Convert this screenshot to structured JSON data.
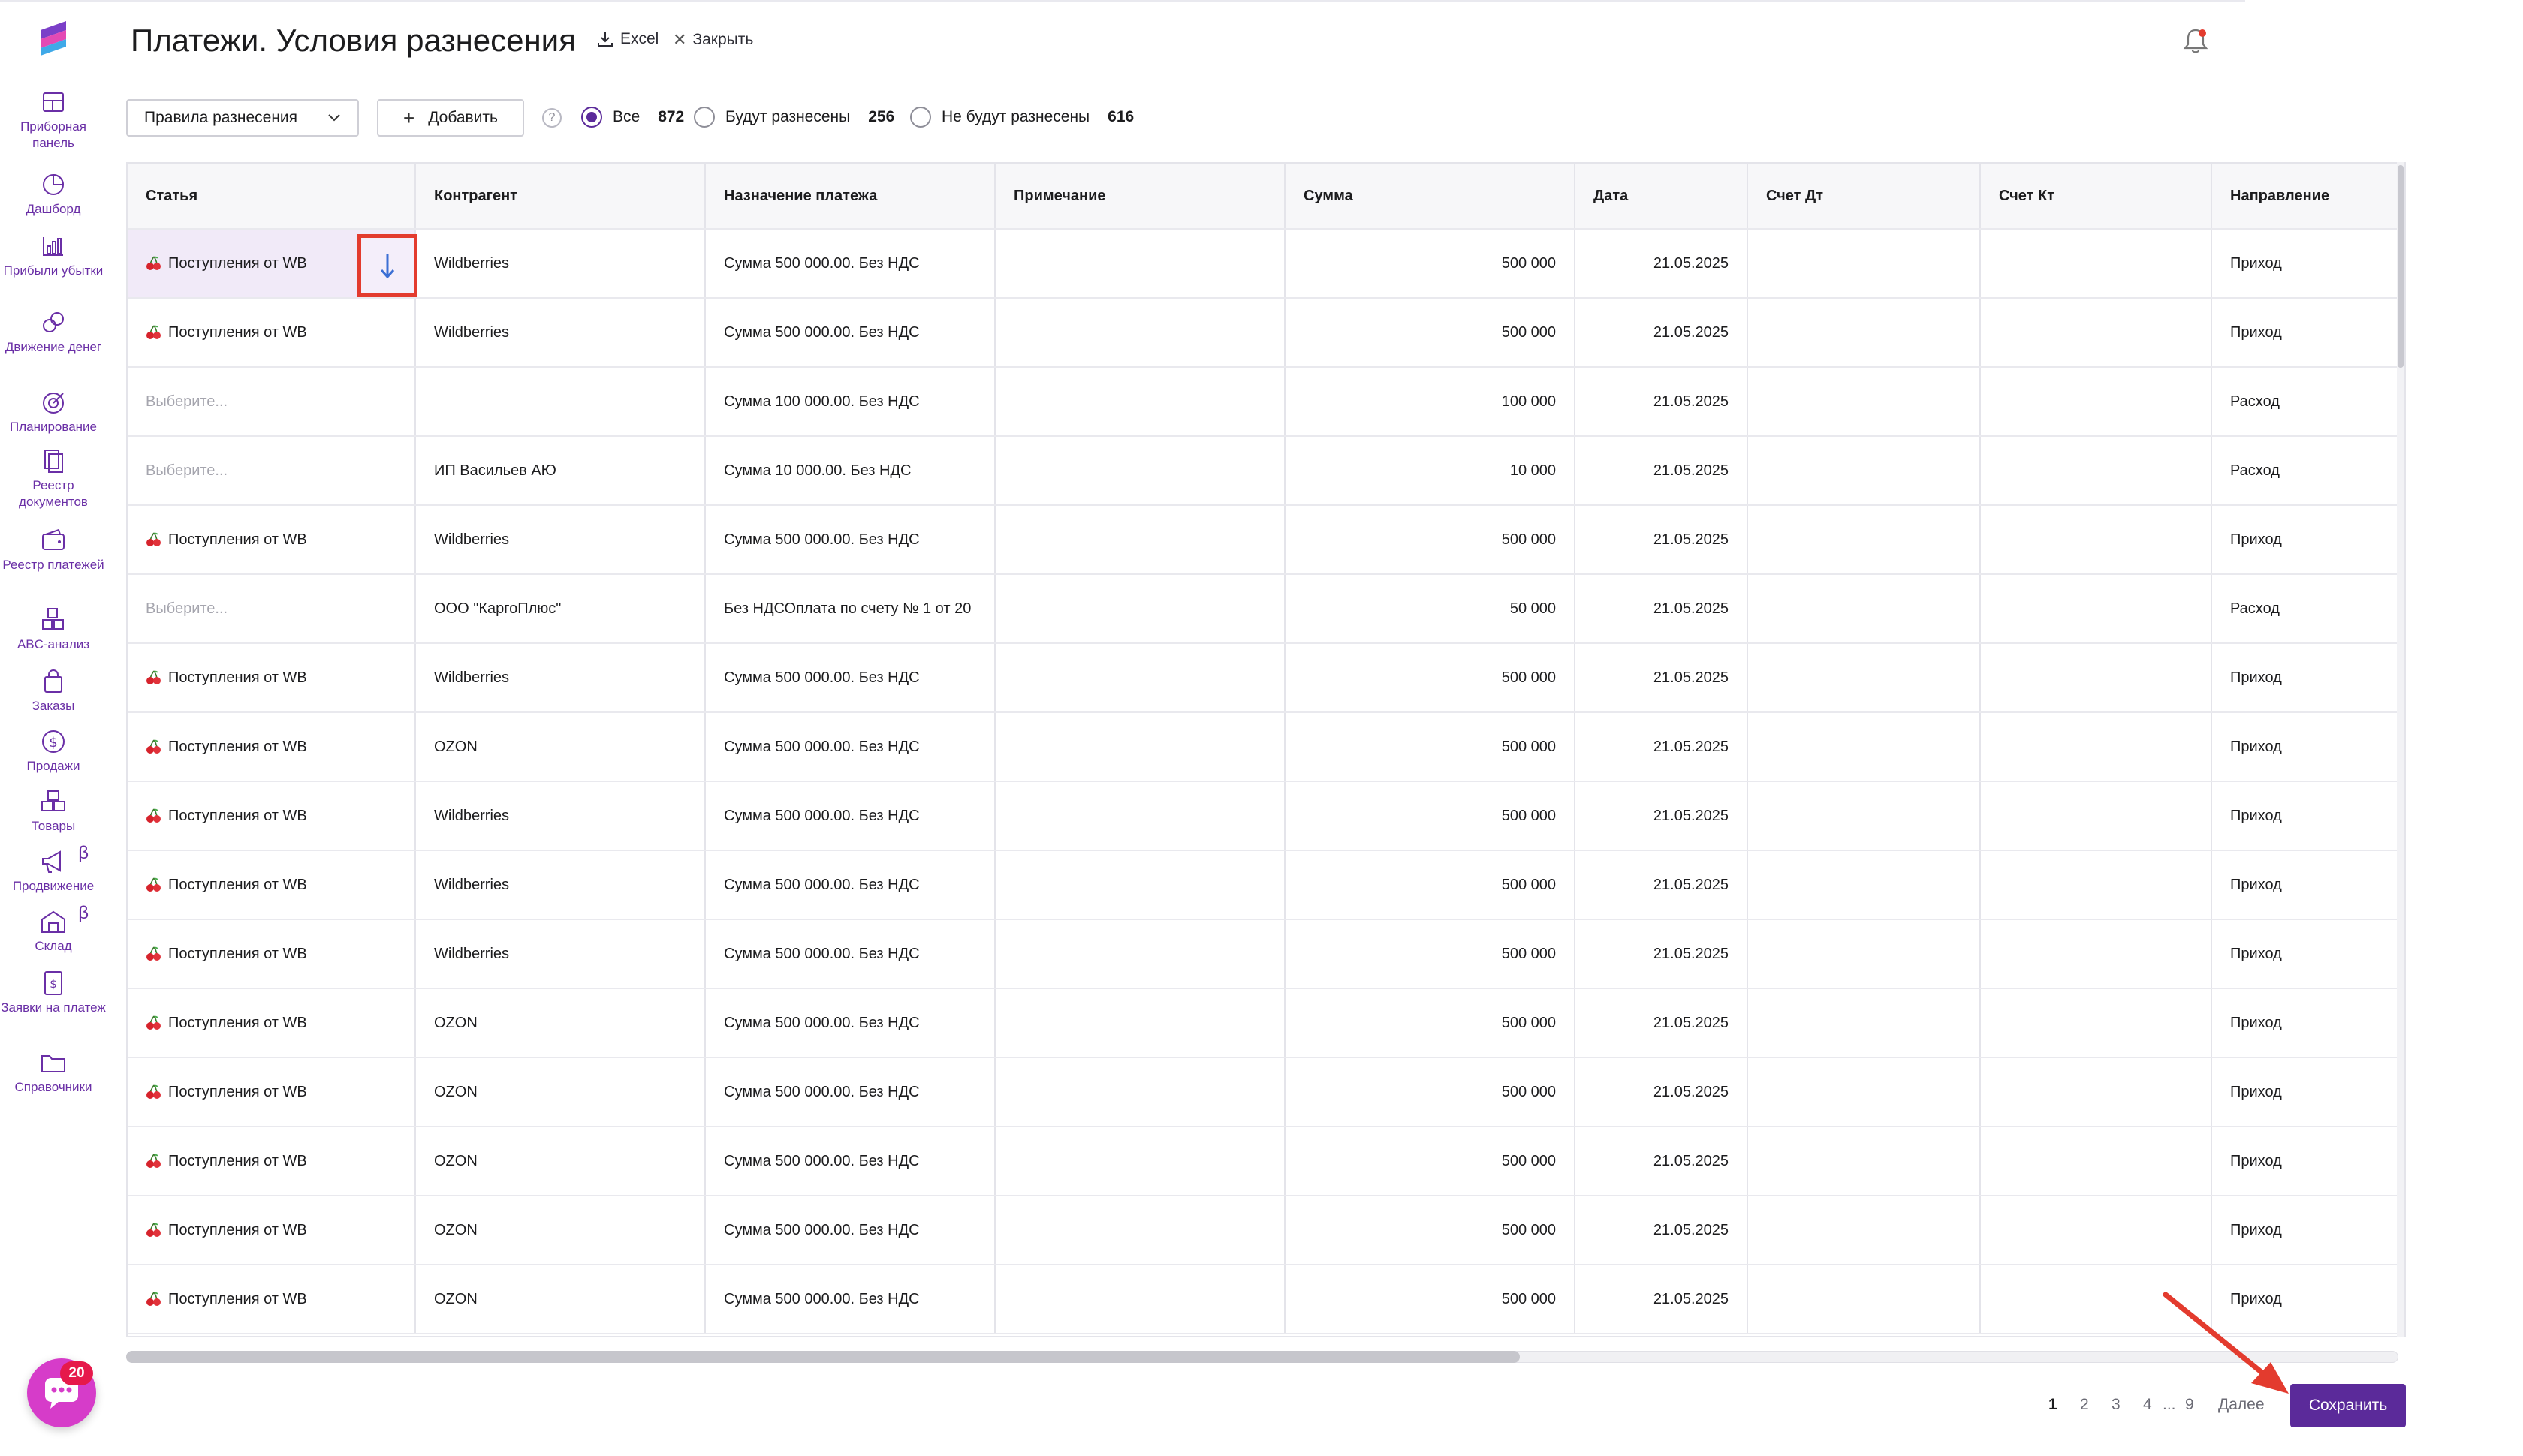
{
  "page": {
    "title": "Платежи. Условия разнесения",
    "excel_label": "Excel",
    "close_label": "Закрыть"
  },
  "sidebar": {
    "items": [
      {
        "label": "Приборная панель",
        "icon": "dashboard-panel-icon"
      },
      {
        "label": "Дашборд",
        "icon": "pie-chart-icon"
      },
      {
        "label": "Прибыли убытки",
        "icon": "bar-chart-icon"
      },
      {
        "label": "Движение денег",
        "icon": "money-flow-icon"
      },
      {
        "label": "Планирование",
        "icon": "target-icon"
      },
      {
        "label": "Реестр документов",
        "icon": "documents-icon"
      },
      {
        "label": "Реестр платежей",
        "icon": "wallet-icon"
      },
      {
        "label": "ABC-анализ",
        "icon": "abc-icon"
      },
      {
        "label": "Заказы",
        "icon": "shopping-bag-icon"
      },
      {
        "label": "Продажи",
        "icon": "dollar-icon"
      },
      {
        "label": "Товары",
        "icon": "boxes-icon"
      },
      {
        "label": "Продвижение",
        "icon": "megaphone-icon",
        "beta": "β"
      },
      {
        "label": "Склад",
        "icon": "warehouse-icon",
        "beta": "β"
      },
      {
        "label": "Заявки на платеж",
        "icon": "payment-request-icon"
      },
      {
        "label": "Справочники",
        "icon": "folder-icon"
      }
    ]
  },
  "chat": {
    "badge": "20"
  },
  "toolbar": {
    "rules_label": "Правила разнесения",
    "add_label": "Добавить",
    "help": "?",
    "filters": [
      {
        "label": "Все",
        "count": "872",
        "selected": true
      },
      {
        "label": "Будут разнесены",
        "count": "256",
        "selected": false
      },
      {
        "label": "Не будут разнесены",
        "count": "616",
        "selected": false
      }
    ]
  },
  "table": {
    "columns": [
      "Статья",
      "Контрагент",
      "Назначение платежа",
      "Примечание",
      "Сумма",
      "Дата",
      "Счет Дт",
      "Счет Кт",
      "Направление"
    ],
    "rows": [
      {
        "article": "Поступления от WB",
        "cherry": true,
        "counterparty": "Wildberries",
        "purpose": "Сумма 500 000.00. Без НДС",
        "note": "",
        "sum": "500 000",
        "date": "21.05.2025",
        "dt": "",
        "kt": "",
        "direction": "Приход"
      },
      {
        "article": "Поступления от WB",
        "cherry": true,
        "counterparty": "Wildberries",
        "purpose": "Сумма 500 000.00. Без НДС",
        "note": "",
        "sum": "500 000",
        "date": "21.05.2025",
        "dt": "",
        "kt": "",
        "direction": "Приход"
      },
      {
        "article": "Выберите...",
        "cherry": false,
        "counterparty": "",
        "purpose": "Сумма 100 000.00. Без НДС",
        "note": "",
        "sum": "100 000",
        "date": "21.05.2025",
        "dt": "",
        "kt": "",
        "direction": "Расход"
      },
      {
        "article": "Выберите...",
        "cherry": false,
        "counterparty": "ИП Васильев АЮ",
        "purpose": "Сумма 10 000.00. Без НДС",
        "note": "",
        "sum": "10 000",
        "date": "21.05.2025",
        "dt": "",
        "kt": "",
        "direction": "Расход"
      },
      {
        "article": "Поступления от WB",
        "cherry": true,
        "counterparty": "Wildberries",
        "purpose": "Сумма 500 000.00. Без НДС",
        "note": "",
        "sum": "500 000",
        "date": "21.05.2025",
        "dt": "",
        "kt": "",
        "direction": "Приход"
      },
      {
        "article": "Выберите...",
        "cherry": false,
        "counterparty": "ООО \"КаргоПлюс\"",
        "purpose": "Без НДСОплата по счету № 1 от 20",
        "note": "",
        "sum": "50 000",
        "date": "21.05.2025",
        "dt": "",
        "kt": "",
        "direction": "Расход"
      },
      {
        "article": "Поступления от WB",
        "cherry": true,
        "counterparty": "Wildberries",
        "purpose": "Сумма 500 000.00. Без НДС",
        "note": "",
        "sum": "500 000",
        "date": "21.05.2025",
        "dt": "",
        "kt": "",
        "direction": "Приход"
      },
      {
        "article": "Поступления от WB",
        "cherry": true,
        "counterparty": "OZON",
        "purpose": "Сумма 500 000.00. Без НДС",
        "note": "",
        "sum": "500 000",
        "date": "21.05.2025",
        "dt": "",
        "kt": "",
        "direction": "Приход"
      },
      {
        "article": "Поступления от WB",
        "cherry": true,
        "counterparty": "Wildberries",
        "purpose": "Сумма 500 000.00. Без НДС",
        "note": "",
        "sum": "500 000",
        "date": "21.05.2025",
        "dt": "",
        "kt": "",
        "direction": "Приход"
      },
      {
        "article": "Поступления от WB",
        "cherry": true,
        "counterparty": "Wildberries",
        "purpose": "Сумма 500 000.00. Без НДС",
        "note": "",
        "sum": "500 000",
        "date": "21.05.2025",
        "dt": "",
        "kt": "",
        "direction": "Приход"
      },
      {
        "article": "Поступления от WB",
        "cherry": true,
        "counterparty": "Wildberries",
        "purpose": "Сумма 500 000.00. Без НДС",
        "note": "",
        "sum": "500 000",
        "date": "21.05.2025",
        "dt": "",
        "kt": "",
        "direction": "Приход"
      },
      {
        "article": "Поступления от WB",
        "cherry": true,
        "counterparty": "OZON",
        "purpose": "Сумма 500 000.00. Без НДС",
        "note": "",
        "sum": "500 000",
        "date": "21.05.2025",
        "dt": "",
        "kt": "",
        "direction": "Приход"
      },
      {
        "article": "Поступления от WB",
        "cherry": true,
        "counterparty": "OZON",
        "purpose": "Сумма 500 000.00. Без НДС",
        "note": "",
        "sum": "500 000",
        "date": "21.05.2025",
        "dt": "",
        "kt": "",
        "direction": "Приход"
      },
      {
        "article": "Поступления от WB",
        "cherry": true,
        "counterparty": "OZON",
        "purpose": "Сумма 500 000.00. Без НДС",
        "note": "",
        "sum": "500 000",
        "date": "21.05.2025",
        "dt": "",
        "kt": "",
        "direction": "Приход"
      },
      {
        "article": "Поступления от WB",
        "cherry": true,
        "counterparty": "OZON",
        "purpose": "Сумма 500 000.00. Без НДС",
        "note": "",
        "sum": "500 000",
        "date": "21.05.2025",
        "dt": "",
        "kt": "",
        "direction": "Приход"
      },
      {
        "article": "Поступления от WB",
        "cherry": true,
        "counterparty": "OZON",
        "purpose": "Сумма 500 000.00. Без НДС",
        "note": "",
        "sum": "500 000",
        "date": "21.05.2025",
        "dt": "",
        "kt": "",
        "direction": "Приход"
      }
    ]
  },
  "pagination": {
    "pages": [
      "1",
      "2",
      "3",
      "4",
      "...",
      "9"
    ],
    "current": "1",
    "next_label": "Далее",
    "save_label": "Сохранить"
  },
  "colors": {
    "brand": "#5b2a9a",
    "sidebar_text": "#6a2fa6",
    "chat_button": "#d63cc9",
    "annotation_red": "#e33b2e"
  }
}
